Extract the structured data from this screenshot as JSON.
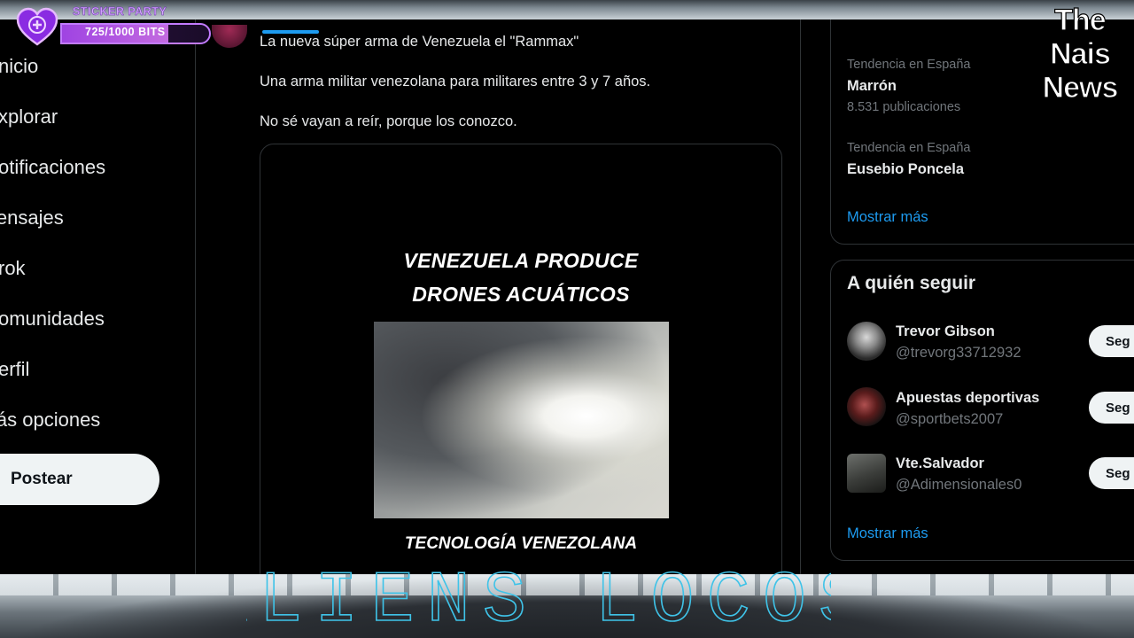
{
  "nav": {
    "items": [
      {
        "label": "Inicio",
        "name": "nav-inicio"
      },
      {
        "label": "Explorar",
        "name": "nav-explorar"
      },
      {
        "label": "Notificaciones",
        "name": "nav-notificaciones"
      },
      {
        "label": "Mensajes",
        "name": "nav-mensajes"
      },
      {
        "label": "Grok",
        "name": "nav-grok"
      },
      {
        "label": "Comunidades",
        "name": "nav-comunidades"
      },
      {
        "label": "Perfil",
        "name": "nav-perfil"
      },
      {
        "label": "Más opciones",
        "name": "nav-mas-opciones"
      }
    ],
    "visible_text": [
      "nicio",
      "xplorar",
      "otificaciones",
      "lensajes",
      "rok",
      "omunidades",
      "erfil",
      "lás opciones"
    ],
    "post_label": "Postear"
  },
  "tweet": {
    "line1": "La nueva súper arma de Venezuela el \"Rammax\"",
    "line2": "Una arma militar venezolana para militares entre 3 y 7 años.",
    "line3": "No sé vayan a reír, porque los conozco.",
    "media": {
      "headline1": "VENEZUELA PRODUCE",
      "headline2": "DRONES ACUÁTICOS",
      "footer": "TECNOLOGÍA VENEZOLANA"
    }
  },
  "trends": {
    "items": [
      {
        "caption": "Tendencia en España",
        "name": "Marrón",
        "count": "8.531 publicaciones"
      },
      {
        "caption": "Tendencia en España",
        "name": "Eusebio Poncela",
        "count": ""
      }
    ],
    "show_more": "Mostrar más"
  },
  "who_to_follow": {
    "title": "A quién seguir",
    "accounts": [
      {
        "name": "Trevor Gibson",
        "handle": "@trevorg33712932",
        "button": "Seg"
      },
      {
        "name": "Apuestas deportivas",
        "handle": "@sportbets2007",
        "button": "Seg"
      },
      {
        "name": "Vte.Salvador",
        "handle": "@Adimensionales0",
        "button": "Seg"
      }
    ],
    "show_more": "Mostrar más"
  },
  "overlay": {
    "sticker_title": "STICKER PARTY",
    "bits_text": "725/1000 BITS",
    "bits_progress": 0.725,
    "logo_lines": [
      "The",
      "Nais",
      "News"
    ],
    "wordmark": "ALIENS LOCOS"
  },
  "colors": {
    "accent": "#1d9bf0",
    "background": "#000000",
    "text": "#e7e9ea",
    "muted": "#71767b",
    "badge_purple": "#b44dff",
    "wordmark_cyan": "#3fc3e8"
  }
}
